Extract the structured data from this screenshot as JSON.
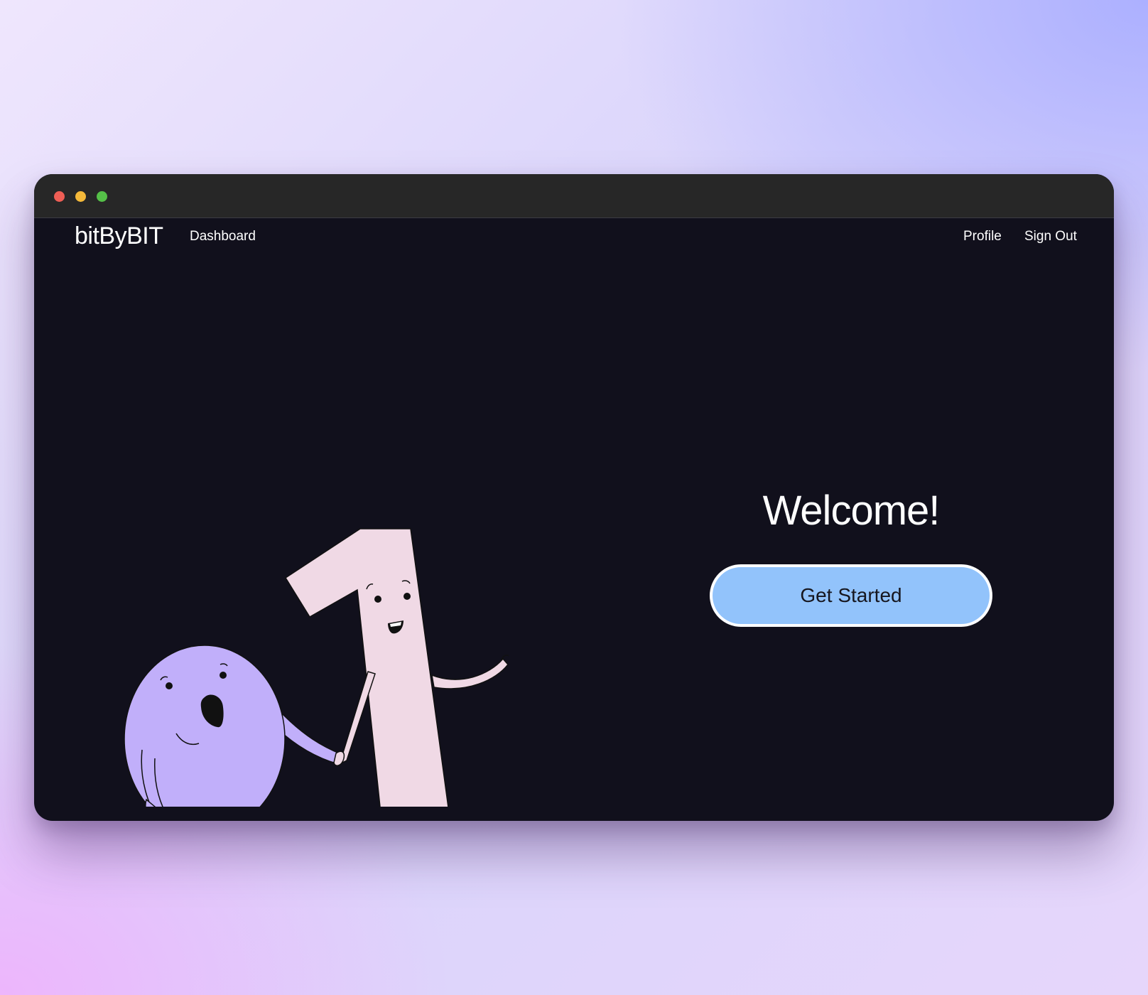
{
  "window": {
    "controls": [
      "close",
      "minimize",
      "maximize"
    ]
  },
  "navbar": {
    "brand": "bitByBIT",
    "links": {
      "dashboard": "Dashboard",
      "profile": "Profile",
      "signout": "Sign Out"
    }
  },
  "hero": {
    "title": "Welcome!",
    "cta_label": "Get Started"
  },
  "colors": {
    "background": "#11101c",
    "titlebar": "#272727",
    "cta": "#92c3fb",
    "zero_character": "#c1affa",
    "one_character": "#f0d9e5"
  },
  "illustration": {
    "characters": [
      "zero-character",
      "one-character"
    ]
  }
}
